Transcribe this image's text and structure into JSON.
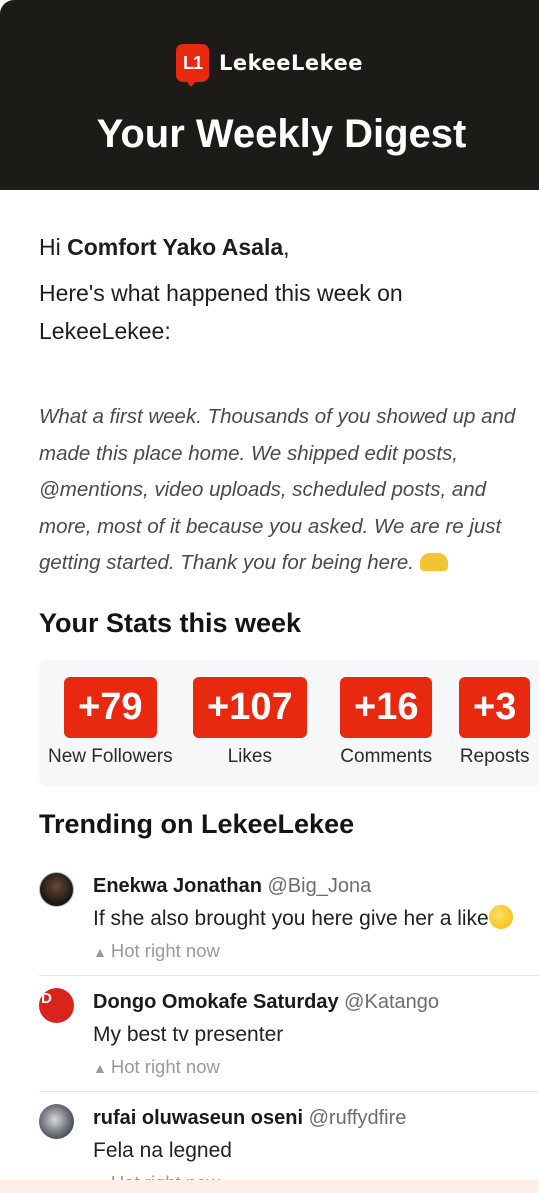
{
  "header": {
    "logo_mark": "L1",
    "brand_name": "LekeeLekee",
    "title": "Your Weekly Digest"
  },
  "greeting": {
    "prefix": "Hi ",
    "name": "Comfort Yako Asala",
    "suffix": ","
  },
  "intro": "Here's what happened this week on LekeeLekee:",
  "message": "What a first week. Thousands of you showed up and made this place home. We shipped edit posts, @mentions, video uploads, scheduled posts, and more, most of it because you asked. We are re just getting started. Thank you for being here.",
  "stats": {
    "title": "Your Stats this week",
    "items": [
      {
        "value": "+79",
        "label": "New Followers"
      },
      {
        "value": "+107",
        "label": "Likes"
      },
      {
        "value": "+16",
        "label": "Comments"
      },
      {
        "value": "+3",
        "label": "Reposts"
      }
    ]
  },
  "trending": {
    "title": "Trending on LekeeLekee",
    "items": [
      {
        "name": "Enekwa Jonathan",
        "handle": "@Big_Jona",
        "text": "If she also brought you here give her a like",
        "hot": "Hot right now",
        "avatar_initial": ""
      },
      {
        "name": "Dongo Omokafe Saturday",
        "handle": "@Katango",
        "text": "My best tv presenter",
        "hot": "Hot right now",
        "avatar_initial": "D"
      },
      {
        "name": "rufai oluwaseun oseni",
        "handle": "@ruffydfire",
        "text": "Fela na legned",
        "hot": "Hot right now",
        "avatar_initial": ""
      }
    ]
  },
  "colors": {
    "accent": "#e8290f",
    "header_bg": "#1c1b18"
  }
}
